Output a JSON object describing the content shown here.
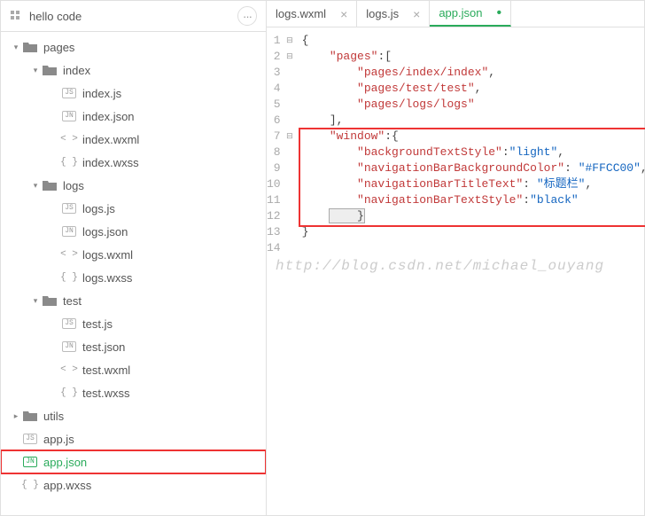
{
  "project": {
    "name": "hello code"
  },
  "tree": {
    "pages": "pages",
    "index": {
      "folder": "index",
      "js": "index.js",
      "json": "index.json",
      "wxml": "index.wxml",
      "wxss": "index.wxss"
    },
    "logs": {
      "folder": "logs",
      "js": "logs.js",
      "json": "logs.json",
      "wxml": "logs.wxml",
      "wxss": "logs.wxss"
    },
    "test": {
      "folder": "test",
      "js": "test.js",
      "json": "test.json",
      "wxml": "test.wxml",
      "wxss": "test.wxss"
    },
    "utils": "utils",
    "appjs": "app.js",
    "appjson": "app.json",
    "appwxss": "app.wxss"
  },
  "tabs": {
    "wxml": "logs.wxml",
    "js": "logs.js",
    "appjson": "app.json"
  },
  "code": {
    "l1": "{",
    "l2a": "    ",
    "l2b": "\"pages\"",
    "l2c": ":[",
    "l3a": "        ",
    "l3b": "\"pages/index/index\"",
    "l3c": ",",
    "l4a": "        ",
    "l4b": "\"pages/test/test\"",
    "l4c": ",",
    "l5a": "        ",
    "l5b": "\"pages/logs/logs\"",
    "l6": "    ],",
    "l7a": "    ",
    "l7b": "\"window\"",
    "l7c": ":{",
    "l8a": "        ",
    "l8b": "\"backgroundTextStyle\"",
    "l8c": ":",
    "l8d": "\"light\"",
    "l8e": ",",
    "l9a": "        ",
    "l9b": "\"navigationBarBackgroundColor\"",
    "l9c": ": ",
    "l9d": "\"#FFCC00\"",
    "l9e": ",",
    "l10a": "        ",
    "l10b": "\"navigationBarTitleText\"",
    "l10c": ": ",
    "l10d": "\"标题栏\"",
    "l10e": ",",
    "l11a": "        ",
    "l11b": "\"navigationBarTextStyle\"",
    "l11c": ":",
    "l11d": "\"black\"",
    "l12": "    }",
    "l13": "}"
  },
  "lineNumbers": {
    "n1": "1",
    "n2": "2",
    "n3": "3",
    "n4": "4",
    "n5": "5",
    "n6": "6",
    "n7": "7",
    "n8": "8",
    "n9": "9",
    "n10": "10",
    "n11": "11",
    "n12": "12",
    "n13": "13",
    "n14": "14"
  },
  "watermark": "http://blog.csdn.net/michael_ouyang",
  "icons": {
    "js": "JS",
    "jn": "JN",
    "wxml": "< >",
    "wxss": "{ }"
  }
}
